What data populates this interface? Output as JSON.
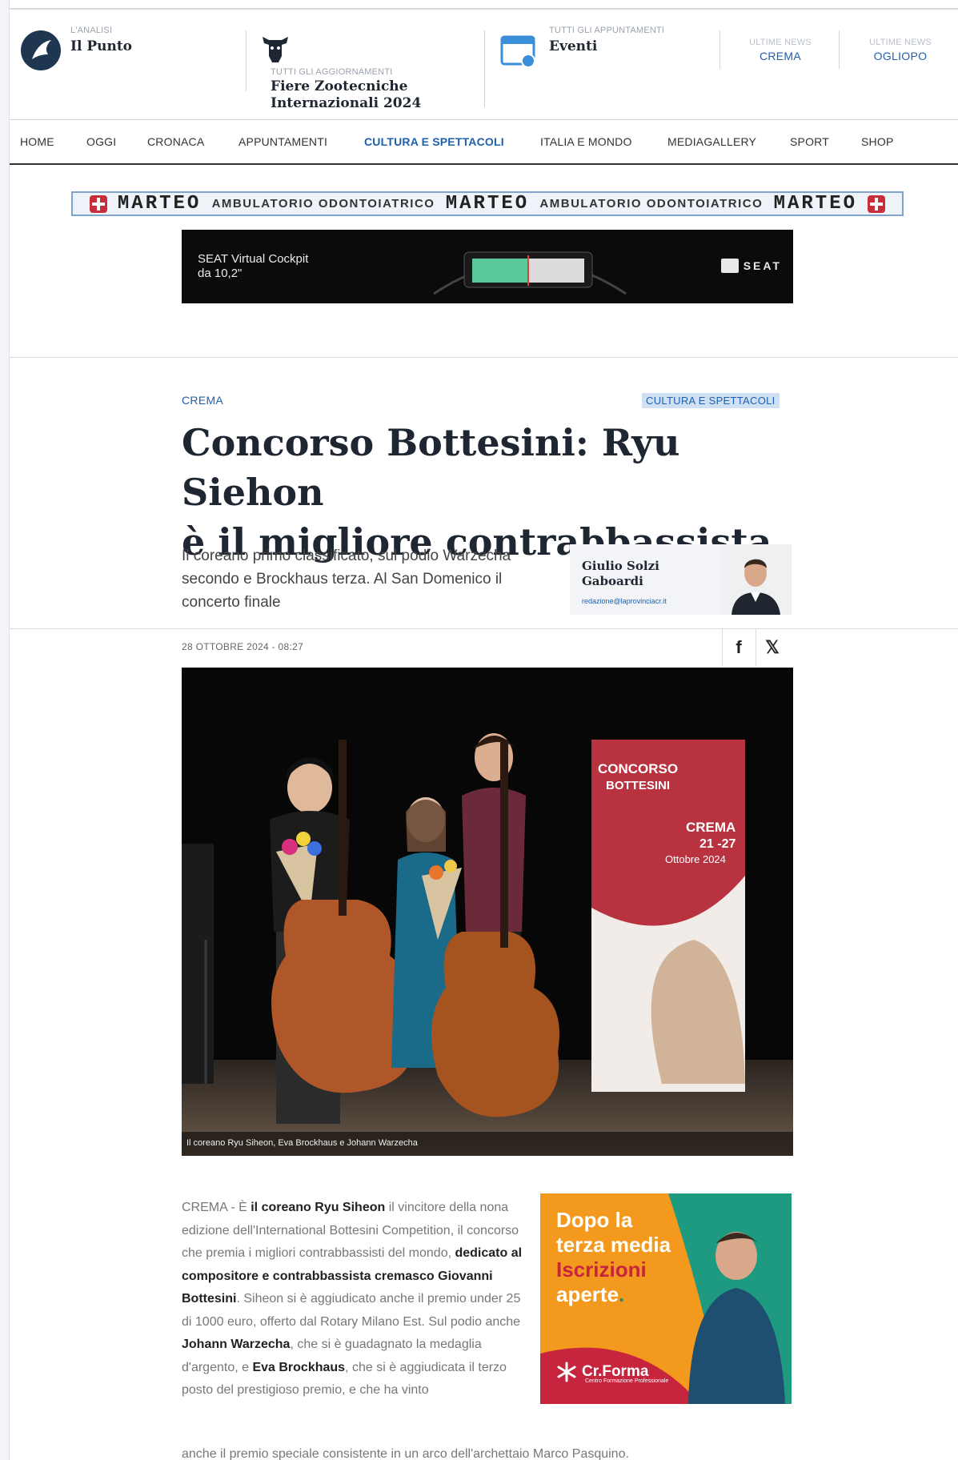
{
  "topstrip": {
    "analisi": {
      "kicker": "L'ANALISI",
      "title": "Il Punto"
    },
    "aggiornamenti": {
      "kicker": "TUTTI GLI AGGIORNAMENTI",
      "title_line1": "Fiere Zootecniche",
      "title_line2": "Internazionali 2024"
    },
    "appuntamenti": {
      "kicker": "TUTTI GLI APPUNTAMENTI",
      "title": "Eventi"
    },
    "news1": {
      "kicker": "ULTIME NEWS",
      "value": "CREMA"
    },
    "news2": {
      "kicker": "ULTIME NEWS",
      "value": "OGLIOPO"
    }
  },
  "nav": {
    "items": [
      "HOME",
      "OGGI",
      "CRONACA",
      "APPUNTAMENTI",
      "CULTURA E SPETTACOLI",
      "ITALIA E MONDO",
      "MEDIAGALLERY",
      "SPORT",
      "SHOP"
    ],
    "active": "CULTURA E SPETTACOLI"
  },
  "banner1": {
    "brand": "MARTEO",
    "text": "AMBULATORIO ODONTOIATRICO"
  },
  "banner2": {
    "line1": "SEAT Virtual Cockpit",
    "line2": "da 10,2\"",
    "brand": "SEAT"
  },
  "article": {
    "category_left": "CREMA",
    "category_right": "CULTURA E SPETTACOLI",
    "headline_line1": "Concorso Bottesini: Ryu Siehon",
    "headline_line2": "è il migliore contrabbassista",
    "subtitle": "Il coreano primo classificato, sul podio Warzecha secondo e Brockhaus terza. Al San Domenico il concerto finale",
    "author_line1": "Giulio Solzi",
    "author_line2": "Gaboardi",
    "author_email": "redazione@laprovinciacr.it",
    "date": "28 OTTOBRE 2024 - 08:27",
    "share_facebook": "f",
    "share_x": "𝕏",
    "photo_caption": "Il coreano Ryu Siheon, Eva Brockhaus e Johann Warzecha",
    "photo_banner": {
      "line1": "CONCORSO",
      "line2": "BOTTESINI",
      "city": "CREMA",
      "dates": "21 -27",
      "month": "Ottobre 2024"
    },
    "body": {
      "p1_a": "CREMA - È ",
      "p1_b": "il coreano Ryu Siheon",
      "p1_c": " il vincitore della nona edizione dell'International Bottesini Competition, il concorso che premia i migliori contrabbassisti del mondo, ",
      "p1_d": "dedicato al compositore e contrabbassista cremasco Giovanni Bottesini",
      "p1_e": ". Siheon si è aggiudicato anche il premio under 25 di 1000 euro, offerto dal Rotary Milano Est. Sul podio anche ",
      "p1_f": "Johann Warzecha",
      "p1_g": ", che si è guadagnato la medaglia d'argento, e ",
      "p1_h": "Eva Brockhaus",
      "p1_i": ", che si è aggiudicata il terzo posto del prestigioso premio, e che ha vinto",
      "p1_last": "anche il premio speciale consistente in un arco dell'archettaio Marco Pasquino."
    }
  },
  "ad": {
    "line1": "Dopo la",
    "line2": "terza media",
    "line3": "Iscrizioni",
    "line4": "aperte",
    "dot": ".",
    "brand": "Cr.Forma",
    "brand_sub": "Centro Formazione Professionale"
  }
}
